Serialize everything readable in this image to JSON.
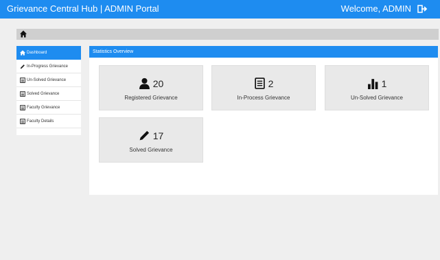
{
  "header": {
    "title": "Grievance Central Hub | ADMIN Portal",
    "welcome": "Welcome, ADMIN",
    "logout_icon": "sign-out-icon"
  },
  "breadcrumb": {
    "home_icon": "home-icon"
  },
  "sidebar": {
    "items": [
      {
        "label": "Dashboard",
        "icon": "home-icon",
        "active": true
      },
      {
        "label": "In-Progress Grievance",
        "icon": "pencil-icon"
      },
      {
        "label": "Un-Solved Grievance",
        "icon": "list-icon"
      },
      {
        "label": "Solved Grievance",
        "icon": "list-icon"
      },
      {
        "label": "Faculty Grievance",
        "icon": "list-icon"
      },
      {
        "label": "Faculty Details",
        "icon": "list-icon"
      }
    ]
  },
  "panel": {
    "title": "Statistics Overview"
  },
  "stats": [
    {
      "count": "20",
      "label": "Registered Grievance",
      "icon": "user-icon"
    },
    {
      "count": "2",
      "label": "In-Process Grievance",
      "icon": "document-icon"
    },
    {
      "count": "1",
      "label": "Un-Solved Grievance",
      "icon": "bar-chart-icon"
    },
    {
      "count": "17",
      "label": "Solved Grievance",
      "icon": "pencil-icon"
    }
  ],
  "colors": {
    "primary": "#1e8cf0",
    "background": "#efefef",
    "card": "#e9e9e9"
  }
}
